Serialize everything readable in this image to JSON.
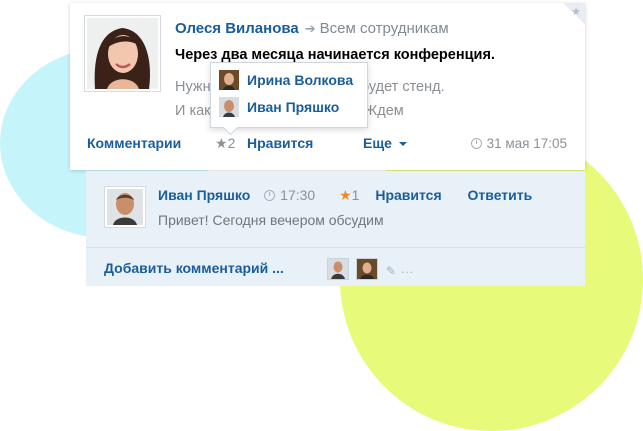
{
  "post": {
    "author": "Олеся Виланова",
    "audience": "Всем сотрудникам",
    "title": "Через два месяца начинается конференция.",
    "body_line1": "Нужно решить, какой у нас будет стенд.",
    "body_line2": "И как мы будем его делать. Ждем"
  },
  "actions": {
    "comments_label": "Комментарии",
    "likes_count": "2",
    "like_label": "Нравится",
    "more_label": "Еще",
    "date": "31 мая 17:05"
  },
  "likes_popup": {
    "users": [
      {
        "name": "Ирина Волкова"
      },
      {
        "name": "Иван Пряшко"
      }
    ]
  },
  "comment": {
    "author": "Иван Пряшко",
    "time": "17:30",
    "likes_count": "1",
    "like_label": "Нравится",
    "reply_label": "Ответить",
    "text": "Привет! Сегодня вечером обсудим"
  },
  "add_comment": {
    "label": "Добавить комментарий ...",
    "more_dots": "..."
  },
  "colors": {
    "link": "#1a5d9b",
    "accent_star": "#f3861d",
    "decor_cyan": "#c5f5fb",
    "decor_lime": "#e8fa7a",
    "comment_bg": "#e8f1f8"
  },
  "icons": [
    "star-icon",
    "arrow-right-icon",
    "clock-icon",
    "chevron-down-icon",
    "paperclip-icon"
  ]
}
